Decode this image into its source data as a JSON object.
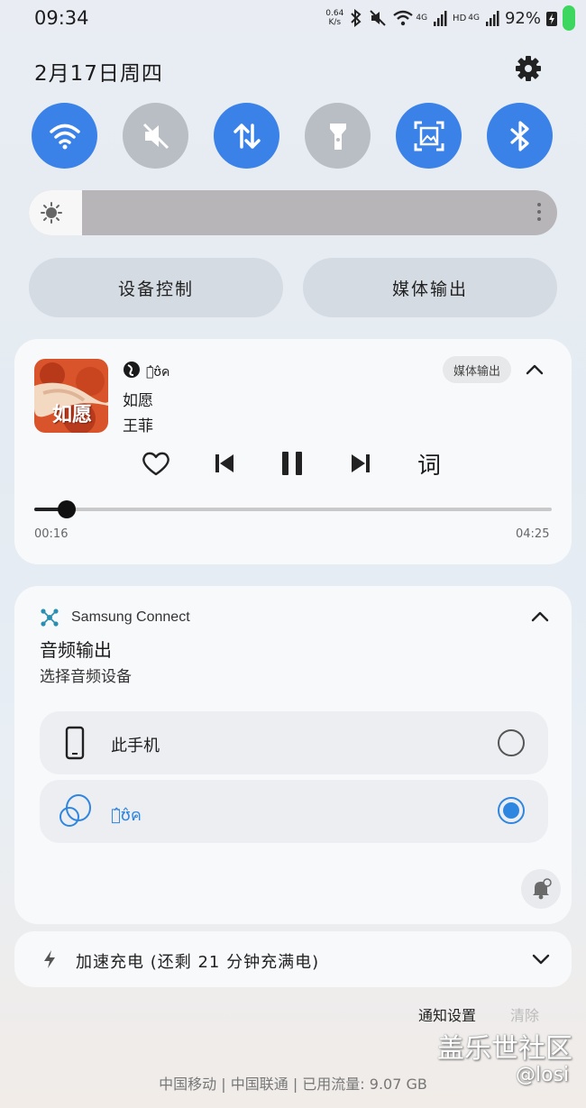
{
  "status_bar": {
    "time": "09:34",
    "speed_value": "0.64",
    "speed_unit": "K/s",
    "network_4g_1": "4G",
    "hd": "HD",
    "network_4g_2": "4G",
    "battery": "92%"
  },
  "header": {
    "date": "2月17日周四"
  },
  "quick_tiles": [
    {
      "name": "wifi",
      "active": true
    },
    {
      "name": "mute",
      "active": false
    },
    {
      "name": "mobile-data",
      "active": true
    },
    {
      "name": "flashlight",
      "active": false
    },
    {
      "name": "screenshot",
      "active": true
    },
    {
      "name": "bluetooth",
      "active": true
    }
  ],
  "brightness": {
    "level_fraction": 0.1
  },
  "quick_buttons": {
    "device_control": "设备控制",
    "media_output": "媒体输出"
  },
  "media": {
    "album_text": "如愿",
    "source_name": "ค̂ʊ̂ค",
    "output_chip": "媒体输出",
    "song": "如愿",
    "artist": "王菲",
    "lyrics_label": "词",
    "current_time": "00:16",
    "total_time": "04:25",
    "progress_fraction": 0.063
  },
  "connect": {
    "app_name": "Samsung Connect",
    "title": "音频输出",
    "subtitle": "选择音频设备",
    "devices": [
      {
        "label": "此手机",
        "selected": false
      },
      {
        "label": "ค̂ʊ̂ค",
        "selected": true
      }
    ]
  },
  "charging": {
    "text": "加速充电 (还剩 21 分钟充满电)"
  },
  "footer": {
    "settings": "通知设置",
    "clear": "清除",
    "carrier_1": "中国移动",
    "separator": "|",
    "carrier_2": "中国联通",
    "data_usage": "已用流量: 9.07 GB"
  },
  "watermark": {
    "line1": "盖乐世社区",
    "line2": "@losi"
  },
  "colors": {
    "accent": "#3b82e8",
    "tile_off": "#b9bdc4",
    "radio_selected": "#2f86e0"
  }
}
